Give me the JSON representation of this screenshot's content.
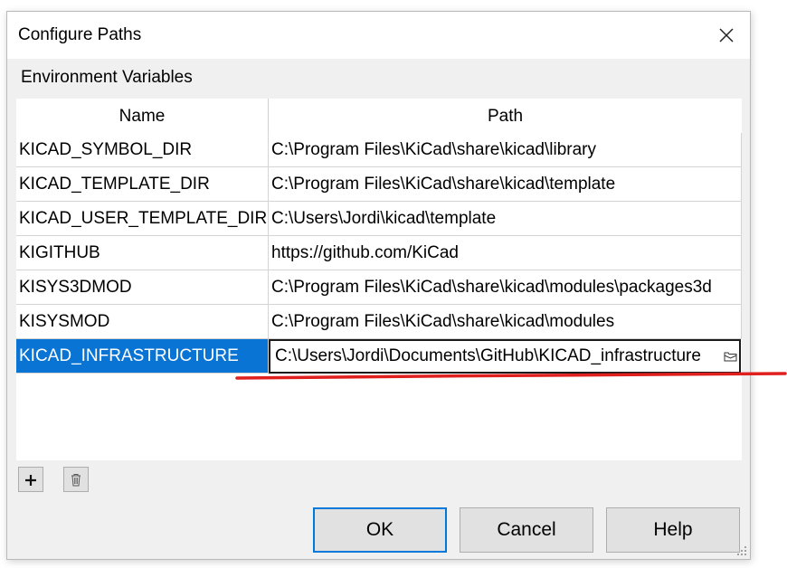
{
  "window": {
    "title": "Configure Paths"
  },
  "group": {
    "label": "Environment Variables"
  },
  "table": {
    "columns": [
      "Name",
      "Path"
    ],
    "rows": [
      {
        "name": "KICAD_SYMBOL_DIR",
        "path": "C:\\Program Files\\KiCad\\share\\kicad\\library"
      },
      {
        "name": "KICAD_TEMPLATE_DIR",
        "path": "C:\\Program Files\\KiCad\\share\\kicad\\template"
      },
      {
        "name": "KICAD_USER_TEMPLATE_DIR",
        "path": "C:\\Users\\Jordi\\kicad\\template"
      },
      {
        "name": "KIGITHUB",
        "path": "https://github.com/KiCad"
      },
      {
        "name": "KISYS3DMOD",
        "path": "C:\\Program Files\\KiCad\\share\\kicad\\modules\\packages3d"
      },
      {
        "name": "KISYSMOD",
        "path": "C:\\Program Files\\KiCad\\share\\kicad\\modules"
      },
      {
        "name": "KICAD_INFRASTRUCTURE",
        "path": "C:\\Users\\Jordi\\Documents\\GitHub\\KICAD_infrastructure"
      }
    ],
    "selected_index": 6
  },
  "toolbar": {
    "add_label": "+",
    "add_icon": "plus-icon",
    "delete_icon": "trash-icon"
  },
  "buttons": {
    "ok": "OK",
    "cancel": "Cancel",
    "help": "Help"
  },
  "colors": {
    "selection": "#0a74d4",
    "annotation": "#e0201e",
    "default_button_border": "#0078d7"
  }
}
